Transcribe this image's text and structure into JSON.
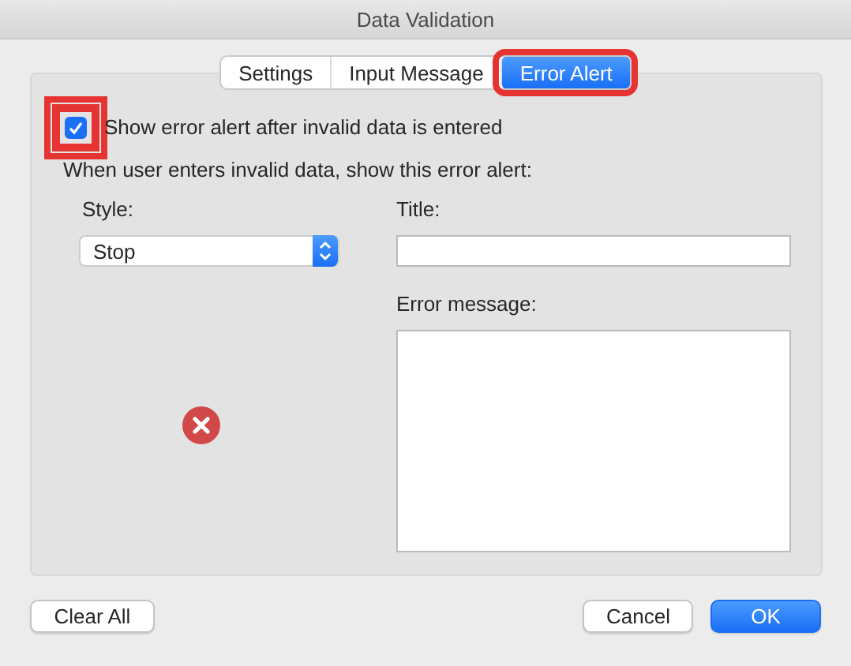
{
  "window": {
    "title": "Data Validation"
  },
  "tabs": [
    {
      "label": "Settings",
      "selected": false,
      "highlighted": false
    },
    {
      "label": "Input Message",
      "selected": false,
      "highlighted": false
    },
    {
      "label": "Error Alert",
      "selected": true,
      "highlighted": true
    }
  ],
  "show_alert": {
    "label": "Show error alert after invalid data is entered",
    "checked": true,
    "highlighted": true
  },
  "intro": "When user enters invalid data, show this error alert:",
  "style": {
    "label": "Style:",
    "value": "Stop"
  },
  "alert_icon": {
    "kind": "stop"
  },
  "title_field": {
    "label": "Title:"
  },
  "message_field": {
    "label": "Error message:"
  },
  "buttons": [
    {
      "label": "Clear All",
      "kind": "secondary"
    },
    {
      "label": "Cancel",
      "kind": "secondary"
    },
    {
      "label": "OK",
      "kind": "default"
    }
  ]
}
